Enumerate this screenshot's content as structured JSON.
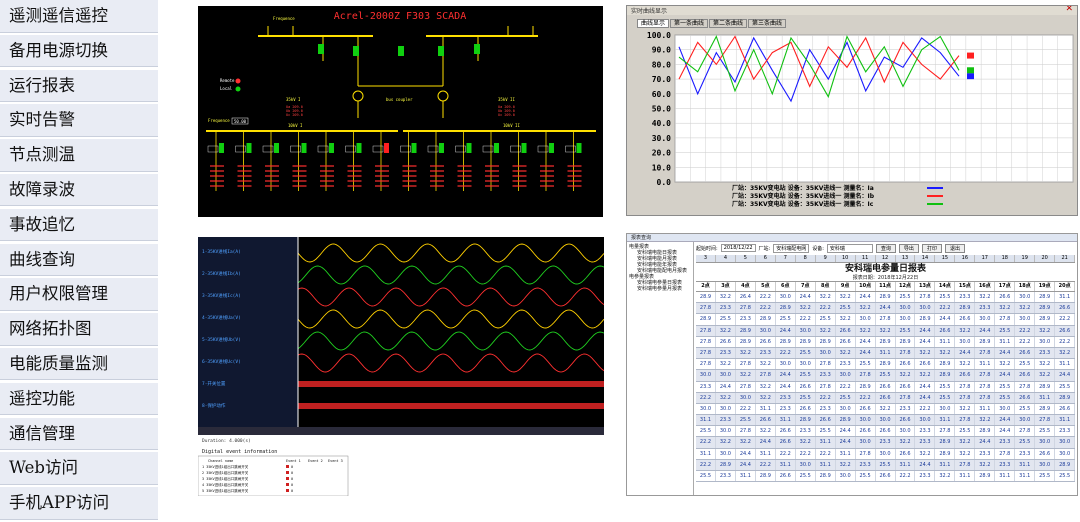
{
  "menu": {
    "items": [
      {
        "label": "遥测遥信遥控"
      },
      {
        "label": "备用电源切换"
      },
      {
        "label": "运行报表"
      },
      {
        "label": "实时告警"
      },
      {
        "label": "节点测温"
      },
      {
        "label": "故障录波"
      },
      {
        "label": "事故追忆"
      },
      {
        "label": "曲线查询"
      },
      {
        "label": "用户权限管理"
      },
      {
        "label": "网络拓扑图"
      },
      {
        "label": "电能质量监测"
      },
      {
        "label": "遥控功能"
      },
      {
        "label": "通信管理"
      },
      {
        "label": "Web访问"
      },
      {
        "label": "手机APP访问"
      }
    ]
  },
  "scada": {
    "title": "Acrel-2000Z F303 SCADA",
    "bus1": "35kV I",
    "bus2": "35kV II",
    "bus_tie": "bus coupler",
    "remote": "Remote",
    "local": "Local",
    "freq_label": "Frequence",
    "freq_value": "50.00",
    "lv_bus1": "10kV I",
    "lv_bus2": "10kV II"
  },
  "curve": {
    "window_title": "实时曲线显示",
    "tabs": [
      "曲线显示",
      "第一条曲线",
      "第二条曲线",
      "第三条曲线"
    ],
    "y_ticks": [
      "100.0",
      "90.0",
      "80.0",
      "70.0",
      "60.0",
      "50.0",
      "40.0",
      "30.0",
      "20.0",
      "10.0",
      "0.0"
    ],
    "legend": [
      {
        "text": "厂站：35KV变电站   设备：35KV进线一   测量名：Ia",
        "color": "#1a1aff"
      },
      {
        "text": "厂站：35KV变电站   设备：35KV进线一   测量名：Ib",
        "color": "#ff2020"
      },
      {
        "text": "厂站：35KV变电站   设备：35KV进线一   测量名：Ic",
        "color": "#10c010"
      }
    ],
    "series": [
      {
        "color": "#1a1aff",
        "values": [
          92,
          60,
          88,
          68,
          98,
          76,
          55,
          90,
          70,
          95,
          62,
          85,
          78,
          98,
          88,
          72
        ]
      },
      {
        "color": "#ff2020",
        "values": [
          70,
          95,
          80,
          99,
          70,
          88,
          95,
          65,
          92,
          78,
          98,
          68,
          95,
          80,
          70,
          86
        ]
      },
      {
        "color": "#10c010",
        "values": [
          85,
          75,
          99,
          62,
          90,
          60,
          98,
          80,
          58,
          99,
          75,
          92,
          65,
          90,
          99,
          76
        ]
      }
    ]
  },
  "wave": {
    "channels": [
      "1-35KV进线Ia(A)",
      "2-35KV进线Ib(A)",
      "3-35KV进线Ic(A)",
      "4-35KV进线Ua(V)",
      "5-35KV进线Ub(V)",
      "6-35KV进线Uc(V)",
      "7-开关位置",
      "8-保护动作"
    ],
    "event_title": "Digital event information",
    "event_headers": [
      "Channel name",
      "Event 1",
      "Event 2",
      "Event 3"
    ],
    "event_rows": [
      [
        "1  35KV进线1组出口跳闸开关",
        "0",
        "",
        ""
      ],
      [
        "2  35KV进线1组出口跳闸开关",
        "0",
        "",
        ""
      ],
      [
        "3  35KV进线1组出口跳闸开关",
        "0",
        "",
        ""
      ],
      [
        "4  35KV进线1组出口跳闸开关",
        "0",
        "",
        ""
      ],
      [
        "5  35KV进线1组出口跳闸开关",
        "0",
        "",
        ""
      ]
    ],
    "duration": "Duration: 4.000(s)"
  },
  "report": {
    "window_title": "报表查询",
    "tree": [
      "电量报表",
      "安科瑞电能日报表",
      "安科瑞电能月报表",
      "安科瑞电能年报表",
      "安科瑞电能配电月报表",
      "电参量报表",
      "安科瑞电参量日报表",
      "安科瑞电参量月报表"
    ],
    "toolbar": {
      "time_label": "起始时间:",
      "time_value": "2018/12/22",
      "site_label": "厂站:",
      "site_value": "安科瑞配电网",
      "device_label": "设备:",
      "device_value": "安科瑞",
      "btn_query": "查询",
      "btn_export": "导出",
      "btn_print": "打印",
      "btn_exit": "退出"
    },
    "title": "安科瑞电参量日报表",
    "subtitle": "报表日期：2018年12月22日",
    "col_numbers": [
      "3",
      "4",
      "5",
      "6",
      "7",
      "8",
      "9",
      "10",
      "11",
      "12",
      "13",
      "14",
      "15",
      "16",
      "17",
      "18",
      "19",
      "20",
      "21"
    ],
    "headers": [
      "2点",
      "3点",
      "4点",
      "5点",
      "6点",
      "7点",
      "8点",
      "9点",
      "10点",
      "11点",
      "12点",
      "13点",
      "14点",
      "15点",
      "16点",
      "17点",
      "18点",
      "19点",
      "20点"
    ],
    "rows": [
      [
        "28.9",
        "32.2",
        "26.4",
        "22.2",
        "30.0",
        "24.4",
        "32.2",
        "32.2",
        "24.4",
        "28.9",
        "25.5",
        "27.8",
        "25.5",
        "23.3",
        "32.2",
        "26.6",
        "30.0",
        "28.9",
        "31.1"
      ],
      [
        "27.8",
        "23.3",
        "27.8",
        "22.2",
        "28.9",
        "32.2",
        "22.2",
        "25.5",
        "32.2",
        "24.4",
        "30.0",
        "30.0",
        "22.2",
        "28.9",
        "23.3",
        "32.2",
        "32.2",
        "28.9",
        "26.6"
      ],
      [
        "28.9",
        "25.5",
        "23.3",
        "28.9",
        "25.5",
        "22.2",
        "25.5",
        "32.2",
        "30.0",
        "27.8",
        "30.0",
        "28.9",
        "24.4",
        "26.6",
        "30.0",
        "27.8",
        "30.0",
        "28.9",
        "22.2"
      ],
      [
        "27.8",
        "32.2",
        "28.9",
        "30.0",
        "24.4",
        "30.0",
        "32.2",
        "26.6",
        "32.2",
        "32.2",
        "25.5",
        "24.4",
        "26.6",
        "32.2",
        "24.4",
        "25.5",
        "22.2",
        "32.2",
        "26.6"
      ],
      [
        "27.8",
        "26.6",
        "28.9",
        "26.6",
        "28.9",
        "28.9",
        "28.9",
        "26.6",
        "24.4",
        "28.9",
        "28.9",
        "24.4",
        "31.1",
        "30.0",
        "28.9",
        "31.1",
        "22.2",
        "30.0",
        "22.2"
      ],
      [
        "27.8",
        "23.3",
        "32.2",
        "23.3",
        "22.2",
        "25.5",
        "30.0",
        "32.2",
        "24.4",
        "31.1",
        "27.8",
        "32.2",
        "32.2",
        "24.4",
        "27.8",
        "24.4",
        "26.6",
        "23.3",
        "32.2"
      ],
      [
        "27.8",
        "32.2",
        "27.8",
        "32.2",
        "30.0",
        "30.0",
        "27.8",
        "23.3",
        "25.5",
        "28.9",
        "26.6",
        "26.6",
        "28.9",
        "32.2",
        "31.1",
        "32.2",
        "25.5",
        "32.2",
        "31.1"
      ],
      [
        "30.0",
        "30.0",
        "32.2",
        "27.8",
        "24.4",
        "25.5",
        "23.3",
        "30.0",
        "27.8",
        "25.5",
        "32.2",
        "32.2",
        "28.9",
        "26.6",
        "27.8",
        "24.4",
        "26.6",
        "32.2",
        "24.4"
      ],
      [
        "23.3",
        "24.4",
        "27.8",
        "32.2",
        "24.4",
        "26.6",
        "27.8",
        "22.2",
        "28.9",
        "26.6",
        "26.6",
        "24.4",
        "25.5",
        "27.8",
        "27.8",
        "25.5",
        "27.8",
        "28.9",
        "25.5"
      ],
      [
        "22.2",
        "32.2",
        "30.0",
        "32.2",
        "23.3",
        "25.5",
        "22.2",
        "25.5",
        "22.2",
        "26.6",
        "27.8",
        "24.4",
        "25.5",
        "27.8",
        "27.8",
        "25.5",
        "26.6",
        "31.1",
        "28.9"
      ],
      [
        "30.0",
        "30.0",
        "22.2",
        "31.1",
        "23.3",
        "26.6",
        "23.3",
        "30.0",
        "26.6",
        "32.2",
        "23.3",
        "22.2",
        "30.0",
        "32.2",
        "31.1",
        "30.0",
        "25.5",
        "28.9",
        "26.6"
      ],
      [
        "31.1",
        "23.3",
        "25.5",
        "26.6",
        "31.1",
        "28.9",
        "26.6",
        "28.9",
        "30.0",
        "30.0",
        "26.6",
        "30.0",
        "31.1",
        "27.8",
        "32.2",
        "24.4",
        "30.0",
        "27.8",
        "31.1"
      ],
      [
        "25.5",
        "30.0",
        "27.8",
        "32.2",
        "26.6",
        "23.3",
        "25.5",
        "24.4",
        "26.6",
        "26.6",
        "30.0",
        "23.3",
        "27.8",
        "25.5",
        "28.9",
        "24.4",
        "27.8",
        "25.5",
        "23.3"
      ],
      [
        "22.2",
        "32.2",
        "32.2",
        "24.4",
        "26.6",
        "32.2",
        "31.1",
        "24.4",
        "30.0",
        "23.3",
        "32.2",
        "23.3",
        "28.9",
        "32.2",
        "24.4",
        "23.3",
        "25.5",
        "30.0",
        "30.0"
      ],
      [
        "31.1",
        "30.0",
        "24.4",
        "31.1",
        "22.2",
        "22.2",
        "22.2",
        "31.1",
        "27.8",
        "30.0",
        "26.6",
        "32.2",
        "28.9",
        "32.2",
        "23.3",
        "27.8",
        "23.3",
        "26.6",
        "30.0"
      ],
      [
        "22.2",
        "28.9",
        "24.4",
        "22.2",
        "31.1",
        "30.0",
        "31.1",
        "32.2",
        "23.3",
        "25.5",
        "31.1",
        "24.4",
        "31.1",
        "27.8",
        "32.2",
        "23.3",
        "31.1",
        "30.0",
        "28.9"
      ],
      [
        "25.5",
        "23.3",
        "31.1",
        "28.9",
        "26.6",
        "25.5",
        "28.9",
        "30.0",
        "25.5",
        "26.6",
        "22.2",
        "23.3",
        "32.2",
        "31.1",
        "28.9",
        "31.1",
        "31.1",
        "25.5",
        "25.5"
      ]
    ]
  }
}
